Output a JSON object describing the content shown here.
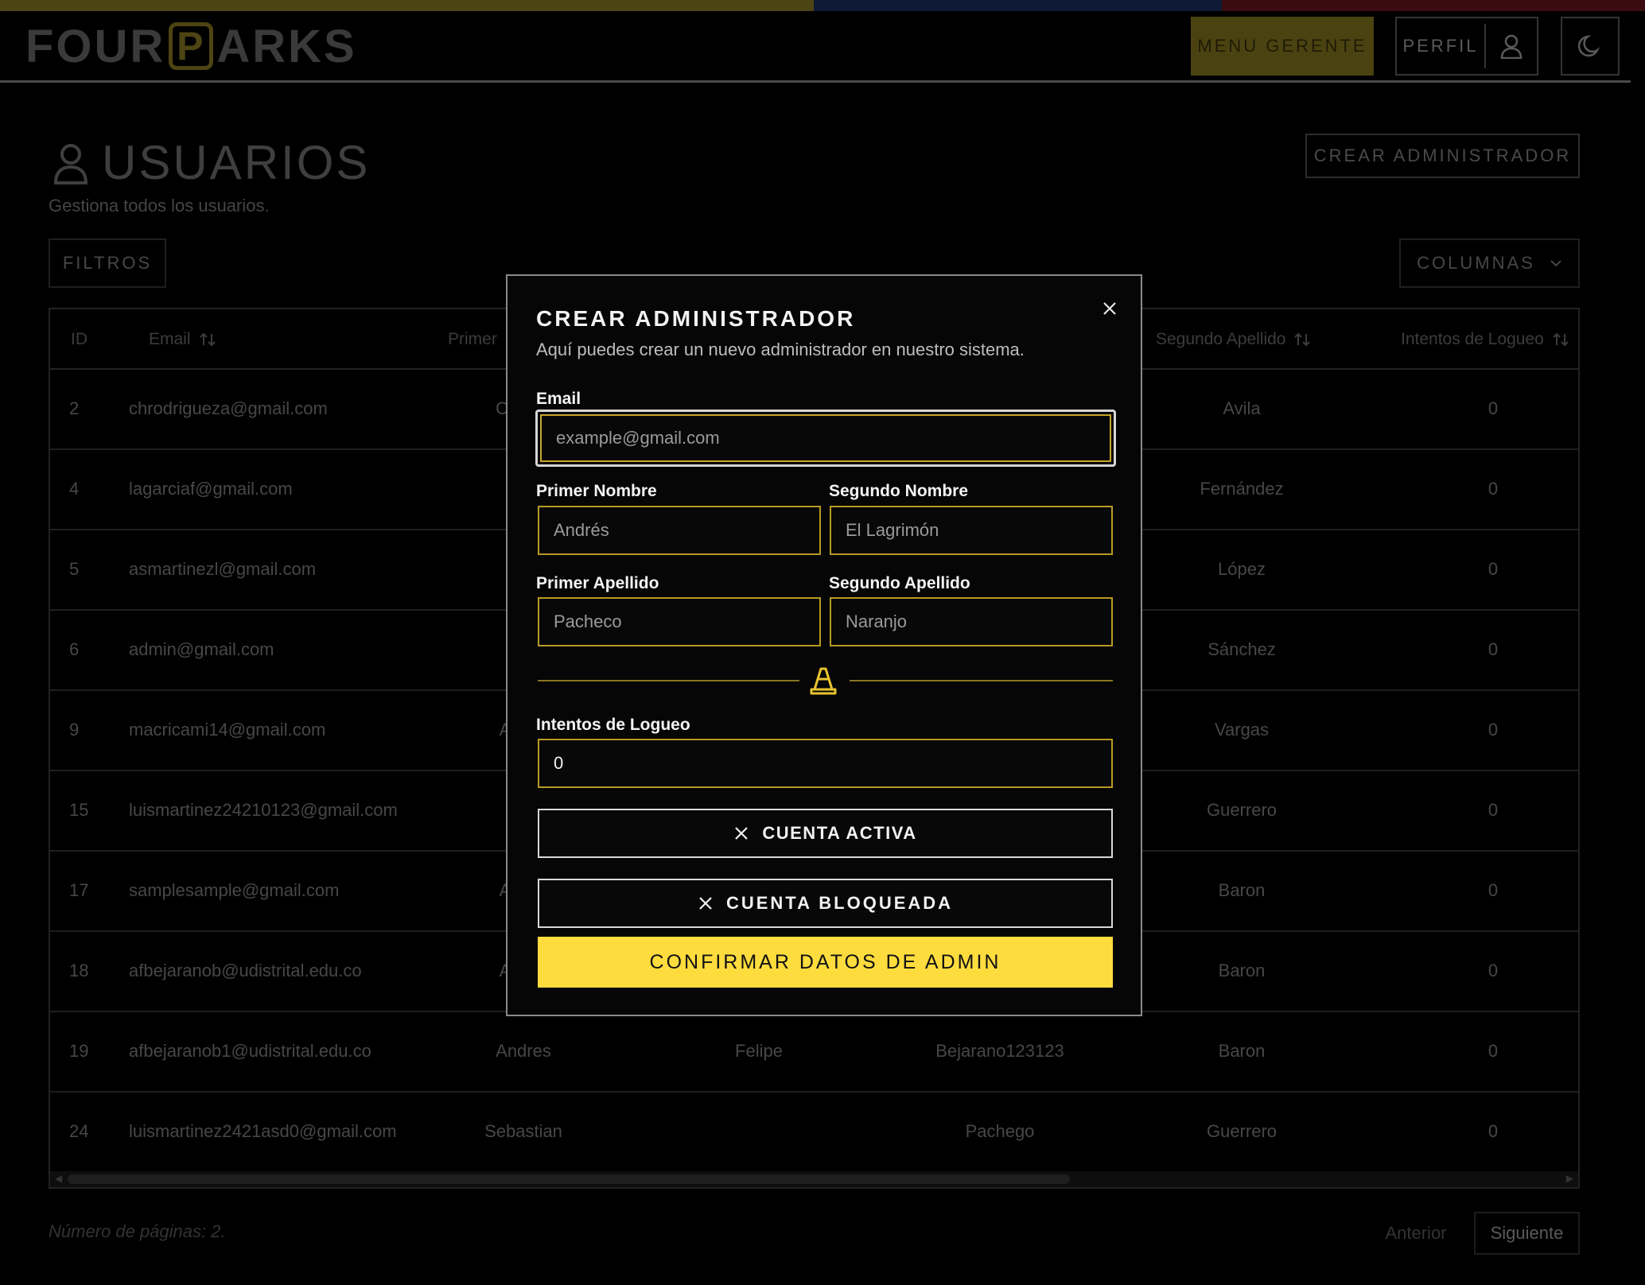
{
  "stripe_colors": [
    "#4d4413",
    "#0e1a36",
    "#3a0c10"
  ],
  "header": {
    "logo": {
      "part1": "FOUR",
      "boxed": "P",
      "part2": "ARKS"
    },
    "menu_gerente_label": "MENU GERENTE",
    "perfil_label": "PERFIL",
    "user_icon": "user-icon",
    "theme_icon": "moon-icon"
  },
  "page": {
    "title": "USUARIOS",
    "subtitle": "Gestiona todos los usuarios.",
    "crear_admin_label": "CREAR ADMINISTRADOR",
    "filtros_label": "FILTROS",
    "columnas_label": "COLUMNAS"
  },
  "table": {
    "headers": {
      "id": "ID",
      "email": "Email",
      "primer": "Primer",
      "segundo_apellido": "Segundo Apellido",
      "intentos": "Intentos de Logueo"
    },
    "rows": [
      {
        "id": "2",
        "email": "chrodrigueza@gmail.com",
        "primer_nombre": "C",
        "segundo_nombre": "",
        "primer_apellido": "",
        "segundo_apellido": "Avila",
        "intentos": "0"
      },
      {
        "id": "4",
        "email": "lagarciaf@gmail.com",
        "primer_nombre": "",
        "segundo_nombre": "",
        "primer_apellido": "",
        "segundo_apellido": "Fernández",
        "intentos": "0"
      },
      {
        "id": "5",
        "email": "asmartinezl@gmail.com",
        "primer_nombre": "",
        "segundo_nombre": "",
        "primer_apellido": "",
        "segundo_apellido": "López",
        "intentos": "0"
      },
      {
        "id": "6",
        "email": "admin@gmail.com",
        "primer_nombre": "",
        "segundo_nombre": "",
        "primer_apellido": "",
        "segundo_apellido": "Sánchez",
        "intentos": "0"
      },
      {
        "id": "9",
        "email": "macricami14@gmail.com",
        "primer_nombre": "A",
        "segundo_nombre": "",
        "primer_apellido": "",
        "segundo_apellido": "Vargas",
        "intentos": "0"
      },
      {
        "id": "15",
        "email": "luismartinez24210123@gmail.com",
        "primer_nombre": "",
        "segundo_nombre": "",
        "primer_apellido": "",
        "segundo_apellido": "Guerrero",
        "intentos": "0"
      },
      {
        "id": "17",
        "email": "samplesample@gmail.com",
        "primer_nombre": "A",
        "segundo_nombre": "",
        "primer_apellido": "",
        "segundo_apellido": "Baron",
        "intentos": "0"
      },
      {
        "id": "18",
        "email": "afbejaranob@udistrital.edu.co",
        "primer_nombre": "A",
        "segundo_nombre": "",
        "primer_apellido": "",
        "segundo_apellido": "Baron",
        "intentos": "0"
      },
      {
        "id": "19",
        "email": "afbejaranob1@udistrital.edu.co",
        "primer_nombre": "Andres",
        "segundo_nombre": "Felipe",
        "primer_apellido": "Bejarano123123",
        "segundo_apellido": "Baron",
        "intentos": "0"
      },
      {
        "id": "24",
        "email": "luismartinez2421asd0@gmail.com",
        "primer_nombre": "Sebastian",
        "segundo_nombre": "",
        "primer_apellido": "Pachego",
        "segundo_apellido": "Guerrero",
        "intentos": "0"
      }
    ]
  },
  "pagination": {
    "pages_text": "Número de páginas: 2.",
    "anterior_label": "Anterior",
    "siguiente_label": "Siguiente"
  },
  "modal": {
    "title": "CREAR ADMINISTRADOR",
    "description": "Aquí puedes crear un nuevo administrador en nuestro sistema.",
    "email_label": "Email",
    "email_placeholder": "example@gmail.com",
    "primer_nombre_label": "Primer Nombre",
    "primer_nombre_placeholder": "Andrés",
    "segundo_nombre_label": "Segundo Nombre",
    "segundo_nombre_placeholder": "El Lagrimón",
    "primer_apellido_label": "Primer Apellido",
    "primer_apellido_placeholder": "Pacheco",
    "segundo_apellido_label": "Segundo Apellido",
    "segundo_apellido_placeholder": "Naranjo",
    "intentos_label": "Intentos de Logueo",
    "intentos_value": "0",
    "cuenta_activa_label": "CUENTA ACTIVA",
    "cuenta_bloqueada_label": "CUENTA BLOQUEADA",
    "confirm_label": "CONFIRMAR DATOS DE ADMIN",
    "accent_color": "#ffdc3e"
  }
}
